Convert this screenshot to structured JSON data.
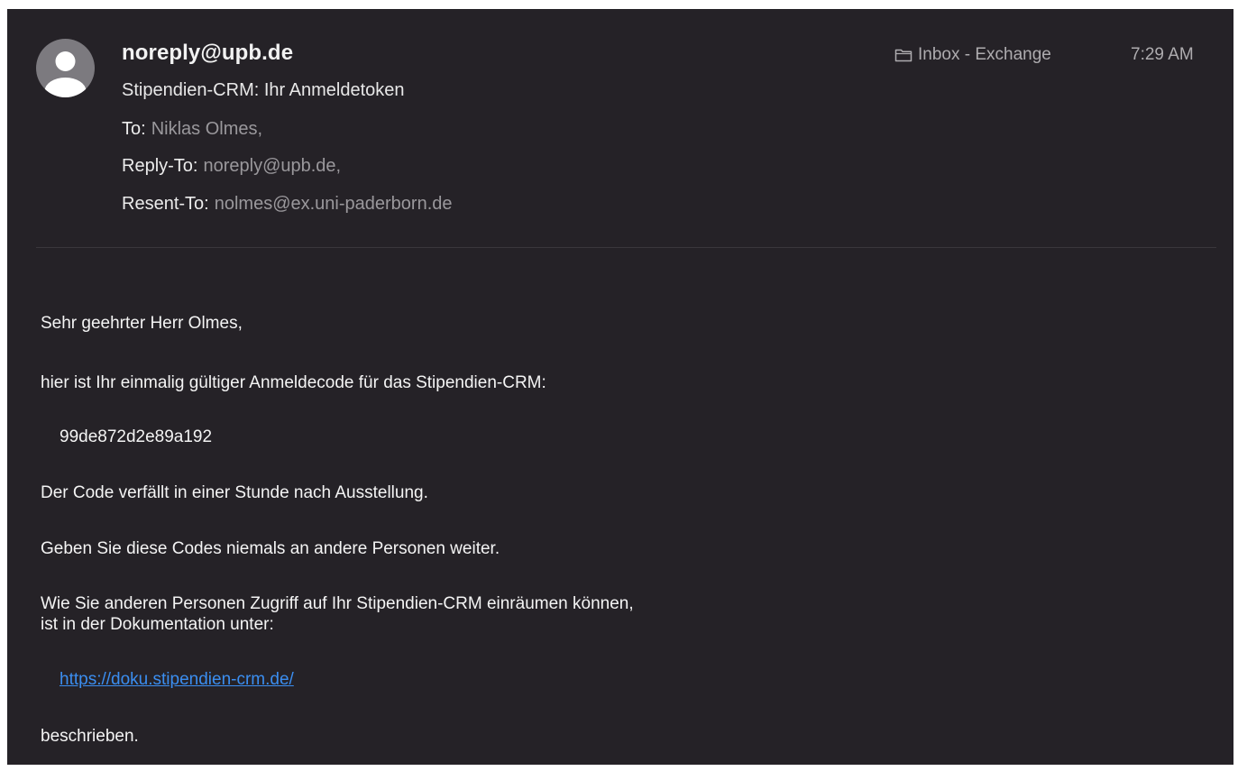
{
  "email": {
    "sender": "noreply@upb.de",
    "subject": "Stipendien-CRM: Ihr Anmeldetoken",
    "to_label": "To:",
    "to_value": "Niklas Olmes,",
    "reply_to_label": "Reply-To:",
    "reply_to_value": "noreply@upb.de,",
    "resent_to_label": "Resent-To:",
    "resent_to_value": "nolmes@ex.uni-paderborn.de",
    "folder": "Inbox - Exchange",
    "folder_icon": "folder-icon",
    "avatar_icon": "person-avatar-icon",
    "time": "7:29 AM"
  },
  "body": {
    "greeting": "Sehr geehrter Herr Olmes,",
    "intro": "hier ist Ihr einmalig gültiger Anmeldecode für das Stipendien-CRM:",
    "code": "99de872d2e89a192",
    "expiry": "Der Code verfällt in einer Stunde nach Ausstellung.",
    "warning": "Geben Sie diese Codes niemals an andere Personen weiter.",
    "access_line1": "Wie Sie anderen Personen Zugriff auf Ihr Stipendien-CRM einräumen können,",
    "access_line2": "ist in der Dokumentation unter:",
    "doc_link": "https://doku.stipendien-crm.de/",
    "closing": "beschrieben."
  },
  "colors": {
    "background": "#252227",
    "link": "#3b8ef0"
  }
}
